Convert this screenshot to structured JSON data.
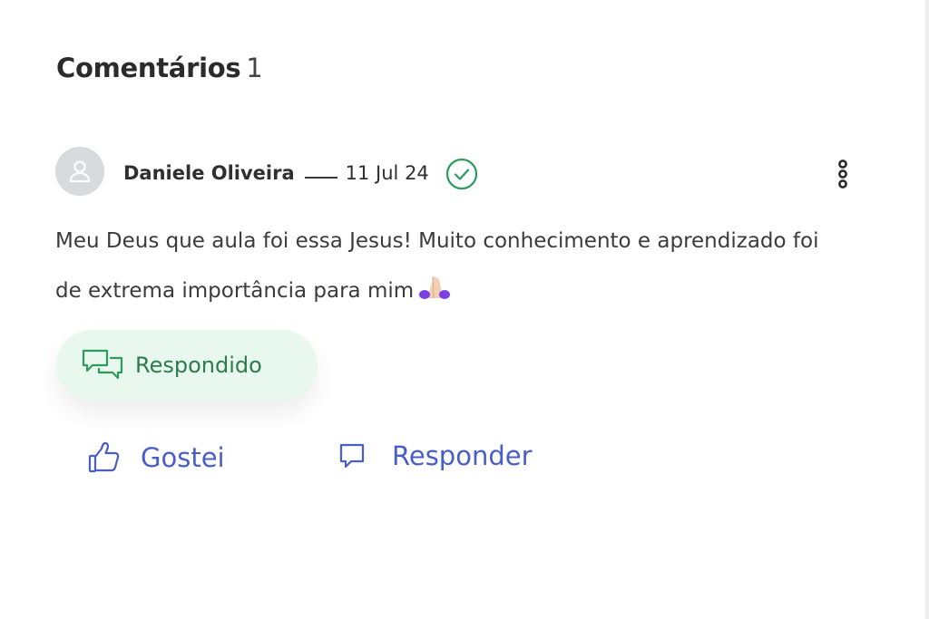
{
  "header": {
    "title": "Comentários",
    "count": "1"
  },
  "comment": {
    "author": "Daniele Oliveira",
    "date": "11 Jul 24",
    "text": "Meu Deus que aula foi essa Jesus! Muito conhecimento e aprendizado foi de extrema importância para mim",
    "emoji": "praying-hands-emoji",
    "status_badge": "Respondido"
  },
  "actions": {
    "like_label": "Gostei",
    "reply_label": "Responder"
  },
  "icons": {
    "avatar": "user-icon",
    "verified": "check-circle-icon",
    "menu": "more-vertical-icon",
    "badge": "chat-bubbles-icon",
    "like": "thumbs-up-icon",
    "reply": "comment-icon"
  },
  "colors": {
    "accent": "#4a5ec9",
    "success": "#2d9b5a",
    "badge_bg": "#e8f8ee",
    "badge_text": "#2d7c4d"
  }
}
